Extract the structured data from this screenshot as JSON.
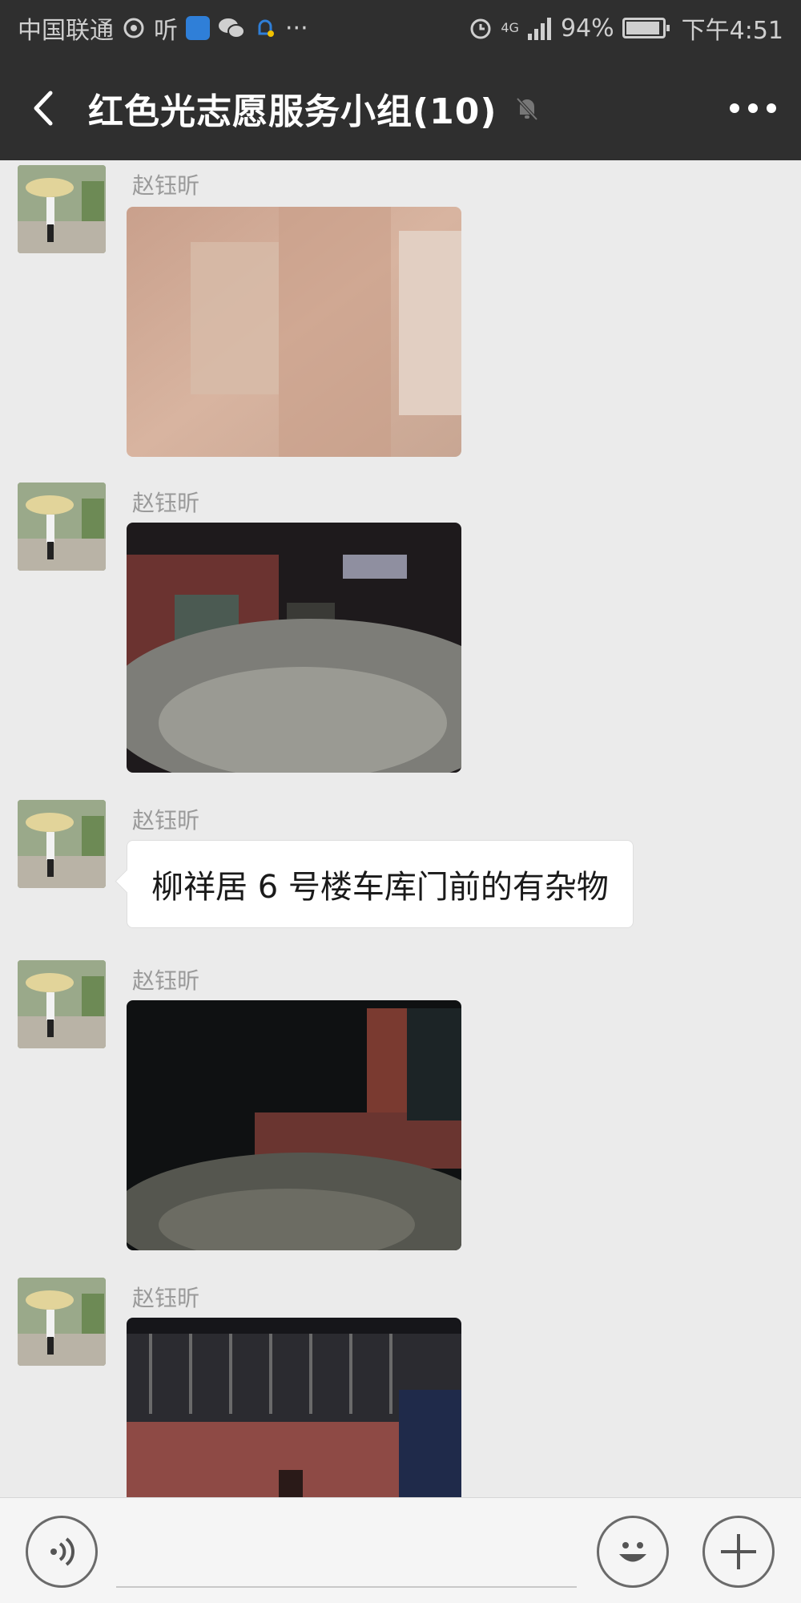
{
  "status_bar": {
    "carrier": "中国联通",
    "app_glyph": "听",
    "network": "4G",
    "battery_percent": "94%",
    "battery_level": 0.94,
    "time": "下午4:51",
    "more": "···"
  },
  "header": {
    "title": "红色光志愿服务小组(10)",
    "back_icon": "chevron-left-icon",
    "mute_icon": "muted-bell-icon",
    "more_icon": "more-horizontal-icon"
  },
  "messages": [
    {
      "type": "image",
      "sender": "赵钰昕",
      "image_alt": "photo"
    },
    {
      "type": "image",
      "sender": "赵钰昕",
      "image_alt": "photo"
    },
    {
      "type": "text",
      "sender": "赵钰昕",
      "text": "柳祥居 6 号楼车库门前的有杂物"
    },
    {
      "type": "image",
      "sender": "赵钰昕",
      "image_alt": "photo"
    },
    {
      "type": "image",
      "sender": "赵钰昕",
      "image_alt": "photo"
    }
  ],
  "input_bar": {
    "voice_icon": "voice-icon",
    "emoji_icon": "emoji-icon",
    "plus_icon": "plus-icon",
    "input_value": ""
  },
  "colors": {
    "header_bg": "#2f2f2f",
    "chat_bg": "#ebebeb",
    "bubble_bg": "#ffffff"
  }
}
